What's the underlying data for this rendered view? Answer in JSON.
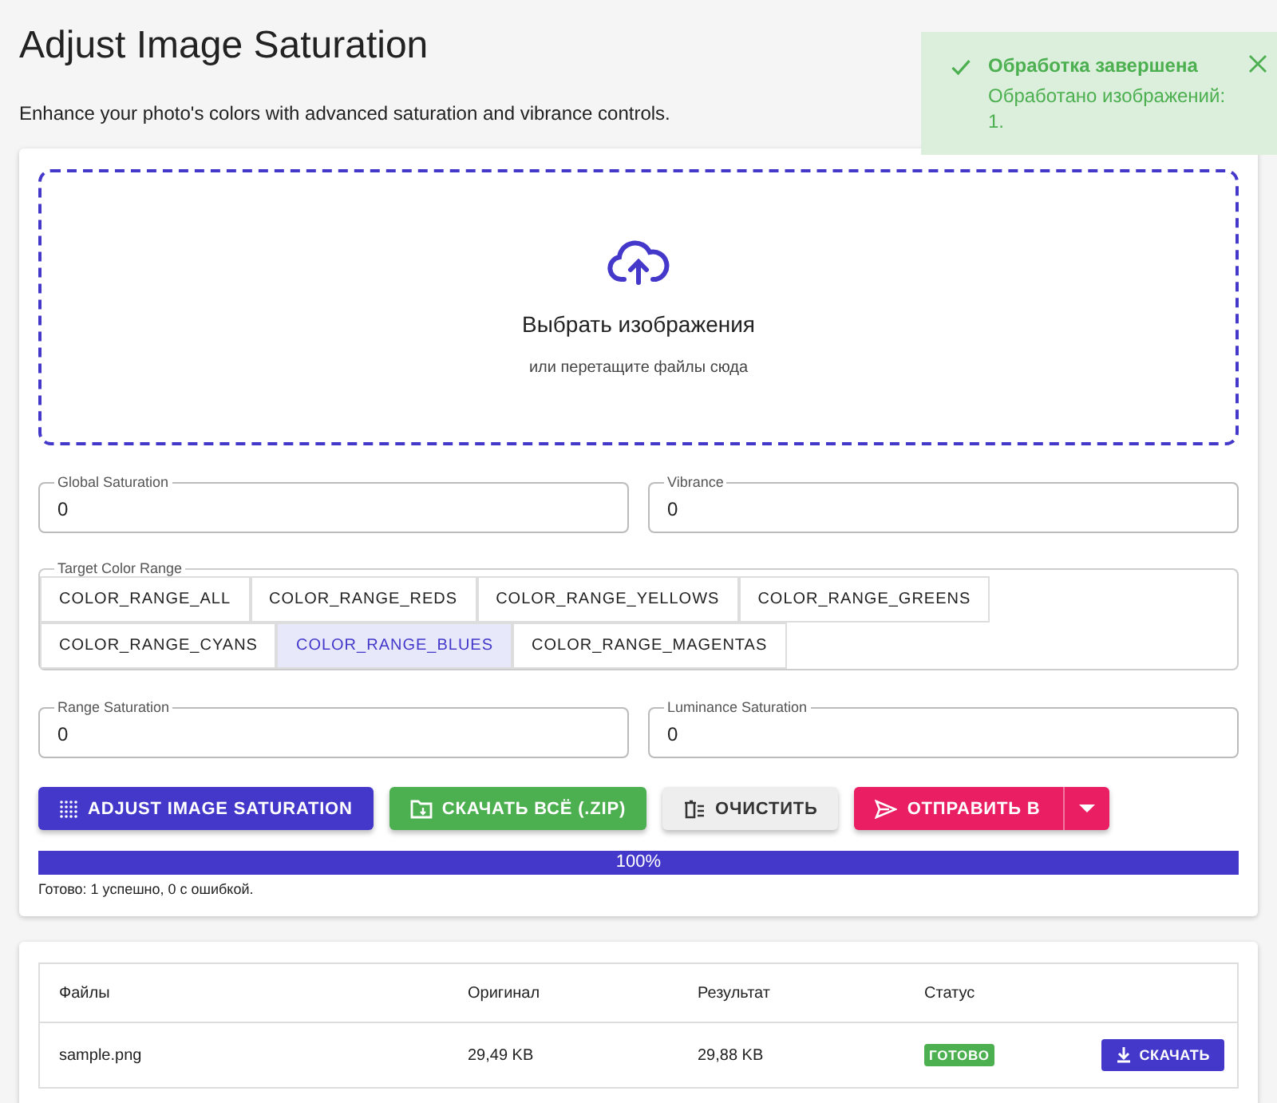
{
  "title": "Adjust Image Saturation",
  "subtitle": "Enhance your photo's colors with advanced saturation and vibrance controls.",
  "toast": {
    "title": "Обработка завершена",
    "message": "Обработано изображений: 1."
  },
  "dropzone": {
    "title": "Выбрать изображения",
    "hint": "или перетащите файлы сюда"
  },
  "fields_top": [
    {
      "label": "Global Saturation",
      "value": "0"
    },
    {
      "label": "Vibrance",
      "value": "0"
    }
  ],
  "color_range": {
    "label": "Target Color Range",
    "options": [
      {
        "label": "COLOR_RANGE_ALL",
        "selected": false
      },
      {
        "label": "COLOR_RANGE_REDS",
        "selected": false
      },
      {
        "label": "COLOR_RANGE_YELLOWS",
        "selected": false
      },
      {
        "label": "COLOR_RANGE_GREENS",
        "selected": false
      },
      {
        "label": "COLOR_RANGE_CYANS",
        "selected": false
      },
      {
        "label": "COLOR_RANGE_BLUES",
        "selected": true
      },
      {
        "label": "COLOR_RANGE_MAGENTAS",
        "selected": false
      }
    ]
  },
  "fields_bottom": [
    {
      "label": "Range Saturation",
      "value": "0"
    },
    {
      "label": "Luminance Saturation",
      "value": "0"
    }
  ],
  "buttons": [
    {
      "label": "ADJUST IMAGE SATURATION",
      "kind": "primary"
    },
    {
      "label": "СКАЧАТЬ ВСЁ (.ZIP)",
      "kind": "success"
    },
    {
      "label": "ОЧИСТИТЬ",
      "kind": "neutral"
    },
    {
      "label": "ОТПРАВИТЬ В",
      "kind": "split"
    }
  ],
  "progress": {
    "level": 1,
    "label": "100%",
    "status": "Готово: 1 успешно, 0 с ошибкой."
  },
  "table": {
    "columns": [
      "Файлы",
      "Оригинал",
      "Результат",
      "Статус"
    ],
    "rows": [
      {
        "file": "sample.png",
        "original": "29,49 KB",
        "result": "29,88 KB",
        "status": "ГОТОВО",
        "action": "СКАЧАТЬ"
      }
    ]
  }
}
